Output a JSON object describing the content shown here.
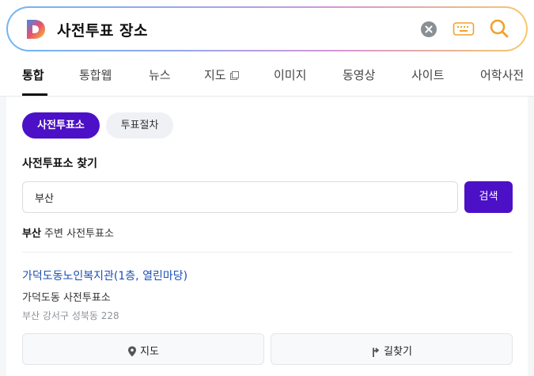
{
  "search": {
    "query": "사전투표 장소",
    "brand_colors": [
      "#6fb6f2",
      "#d897d3",
      "#f6c86a"
    ]
  },
  "tabs": [
    {
      "label": "통합",
      "active": true
    },
    {
      "label": "통합웹"
    },
    {
      "label": "뉴스"
    },
    {
      "label": "지도"
    },
    {
      "label": "이미지"
    },
    {
      "label": "동영상"
    },
    {
      "label": "사이트"
    },
    {
      "label": "어학사전"
    }
  ],
  "filters": {
    "chip1": "사전투표소",
    "chip2": "투표절차"
  },
  "finder": {
    "title": "사전투표소 찾기",
    "input_value": "부산",
    "search_label": "검색",
    "nearby_keyword": "부산",
    "nearby_rest": " 주변 사전투표소"
  },
  "result": {
    "name": "가덕도동노인복지관(1층, 열린마당)",
    "sub": "가덕도동 사전투표소",
    "address": "부산 강서구 성북동 228",
    "map_label": "지도",
    "route_label": "길찾기"
  },
  "colors": {
    "accent": "#4c10c7",
    "link": "#1a4fb5"
  }
}
